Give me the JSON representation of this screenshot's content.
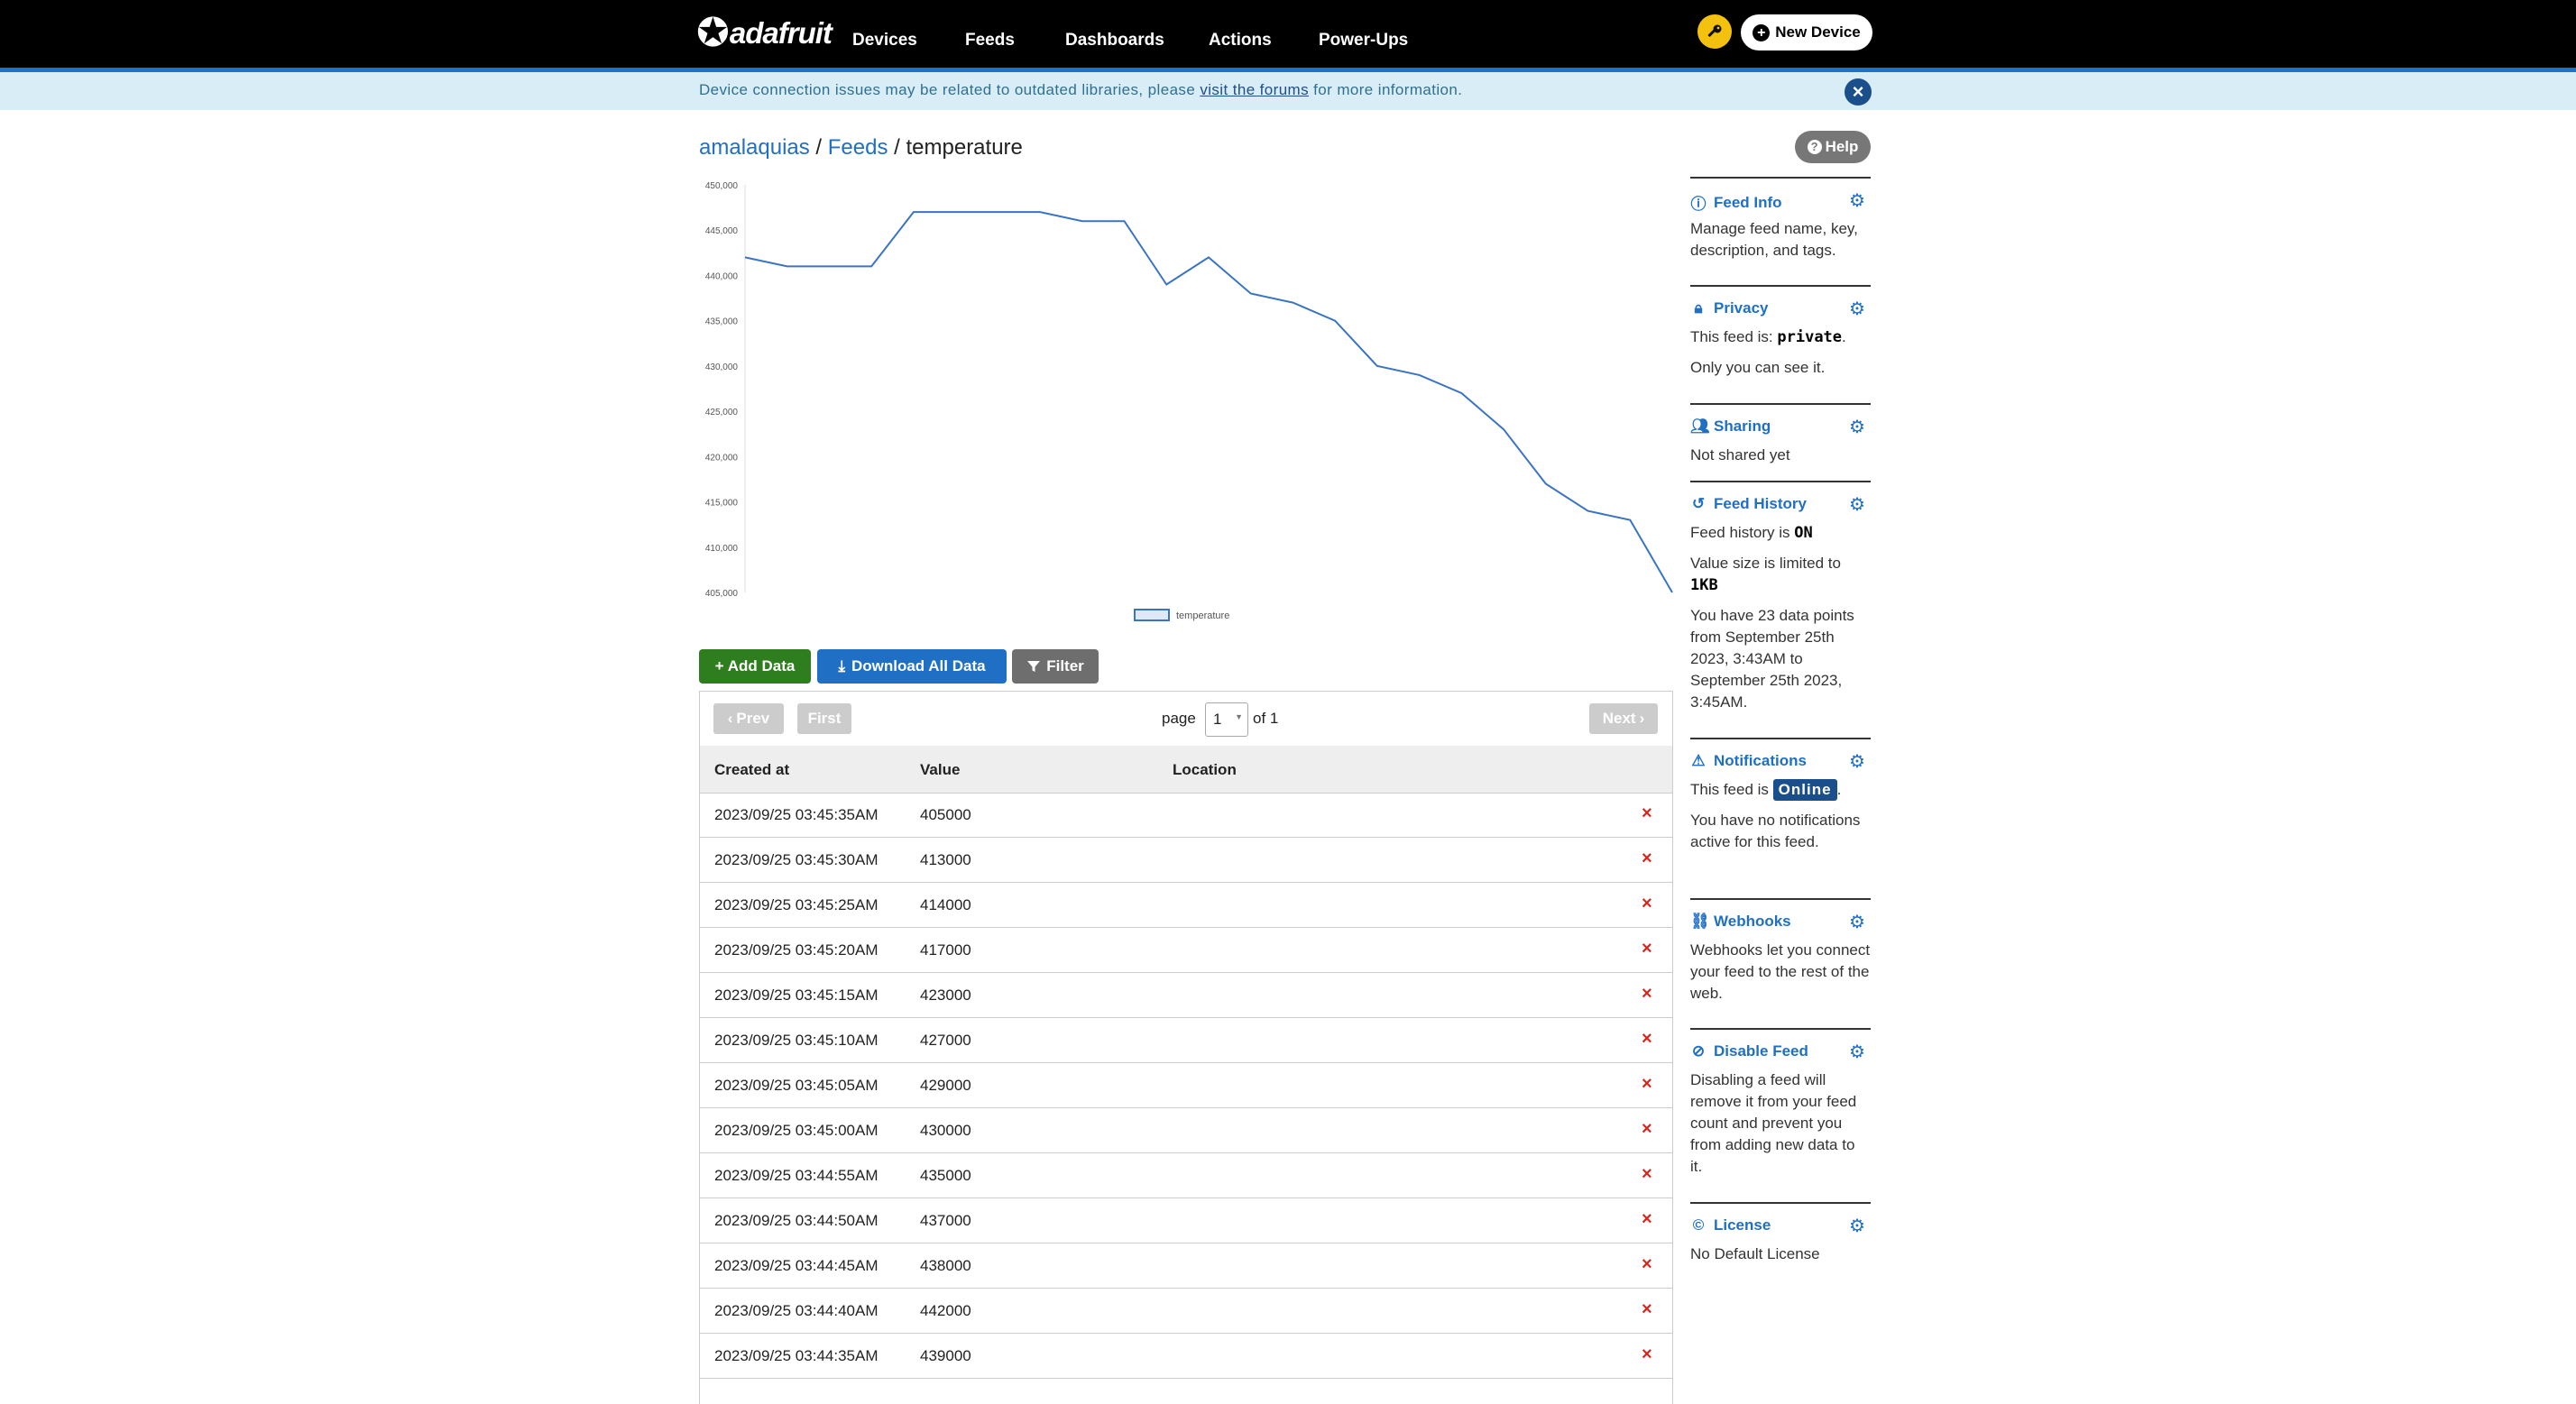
{
  "nav": {
    "logo_text": "adafruit",
    "items": [
      "Devices",
      "Feeds",
      "Dashboards",
      "Actions",
      "Power-Ups"
    ],
    "new_device_label": "New Device"
  },
  "banner": {
    "text_before": "Device connection issues may be related to outdated libraries, please ",
    "link_text": "visit the forums",
    "text_after": " for more information."
  },
  "breadcrumb": {
    "user": "amalaquias",
    "sep": " / ",
    "feeds": "Feeds",
    "current": "temperature"
  },
  "help_label": "Help",
  "chart_data": {
    "type": "line",
    "title": "",
    "xlabel": "",
    "ylabel": "",
    "legend": "temperature",
    "legend_position": "bottom",
    "ylim": [
      405000,
      450000
    ],
    "y_ticks": [
      "450,000",
      "445,000",
      "440,000",
      "435,000",
      "430,000",
      "425,000",
      "420,000",
      "415,000",
      "410,000",
      "405,000"
    ],
    "series": [
      {
        "name": "temperature",
        "color": "#3a74c4",
        "values": [
          442000,
          441000,
          441000,
          441000,
          447000,
          447000,
          447000,
          447000,
          446000,
          446000,
          439000,
          442000,
          438000,
          437000,
          435000,
          430000,
          429000,
          427000,
          423000,
          417000,
          414000,
          413000,
          405000
        ]
      }
    ]
  },
  "buttons": {
    "add": "+ Add Data",
    "download": "Download All Data",
    "filter": "Filter"
  },
  "pager": {
    "prev": "Prev",
    "first": "First",
    "page_label": "page",
    "page_value": "1",
    "of_label": "of 1",
    "next": "Next"
  },
  "table": {
    "headers": [
      "Created at",
      "Value",
      "Location"
    ],
    "rows": [
      {
        "created": "2023/09/25 03:45:35AM",
        "value": "405000"
      },
      {
        "created": "2023/09/25 03:45:30AM",
        "value": "413000"
      },
      {
        "created": "2023/09/25 03:45:25AM",
        "value": "414000"
      },
      {
        "created": "2023/09/25 03:45:20AM",
        "value": "417000"
      },
      {
        "created": "2023/09/25 03:45:15AM",
        "value": "423000"
      },
      {
        "created": "2023/09/25 03:45:10AM",
        "value": "427000"
      },
      {
        "created": "2023/09/25 03:45:05AM",
        "value": "429000"
      },
      {
        "created": "2023/09/25 03:45:00AM",
        "value": "430000"
      },
      {
        "created": "2023/09/25 03:44:55AM",
        "value": "435000"
      },
      {
        "created": "2023/09/25 03:44:50AM",
        "value": "437000"
      },
      {
        "created": "2023/09/25 03:44:45AM",
        "value": "438000"
      },
      {
        "created": "2023/09/25 03:44:40AM",
        "value": "442000"
      },
      {
        "created": "2023/09/25 03:44:35AM",
        "value": "439000"
      }
    ]
  },
  "sidebar": {
    "feed_info": {
      "title": "Feed Info",
      "desc": "Manage feed name, key, description, and tags."
    },
    "privacy": {
      "title": "Privacy",
      "line1_pre": "This feed is: ",
      "line1_val": "private",
      "line1_post": ".",
      "line2": "Only you can see it."
    },
    "sharing": {
      "title": "Sharing",
      "desc": "Not shared yet"
    },
    "history": {
      "title": "Feed History",
      "l1_pre": "Feed history is ",
      "l1_val": "ON",
      "l2_pre": "Value size is limited to ",
      "l2_val": "1KB",
      "l3": "You have 23 data points from September 25th 2023, 3:43AM to September 25th 2023, 3:45AM."
    },
    "notifications": {
      "title": "Notifications",
      "l1_pre": "This feed is ",
      "l1_val": "Online",
      "l1_post": ".",
      "l2": "You have no notifications active for this feed."
    },
    "webhooks": {
      "title": "Webhooks",
      "desc": "Webhooks let you connect your feed to the rest of the web."
    },
    "disable": {
      "title": "Disable Feed",
      "desc": "Disabling a feed will remove it from your feed count and prevent you from adding new data to it."
    },
    "license": {
      "title": "License",
      "desc": "No Default License"
    }
  }
}
